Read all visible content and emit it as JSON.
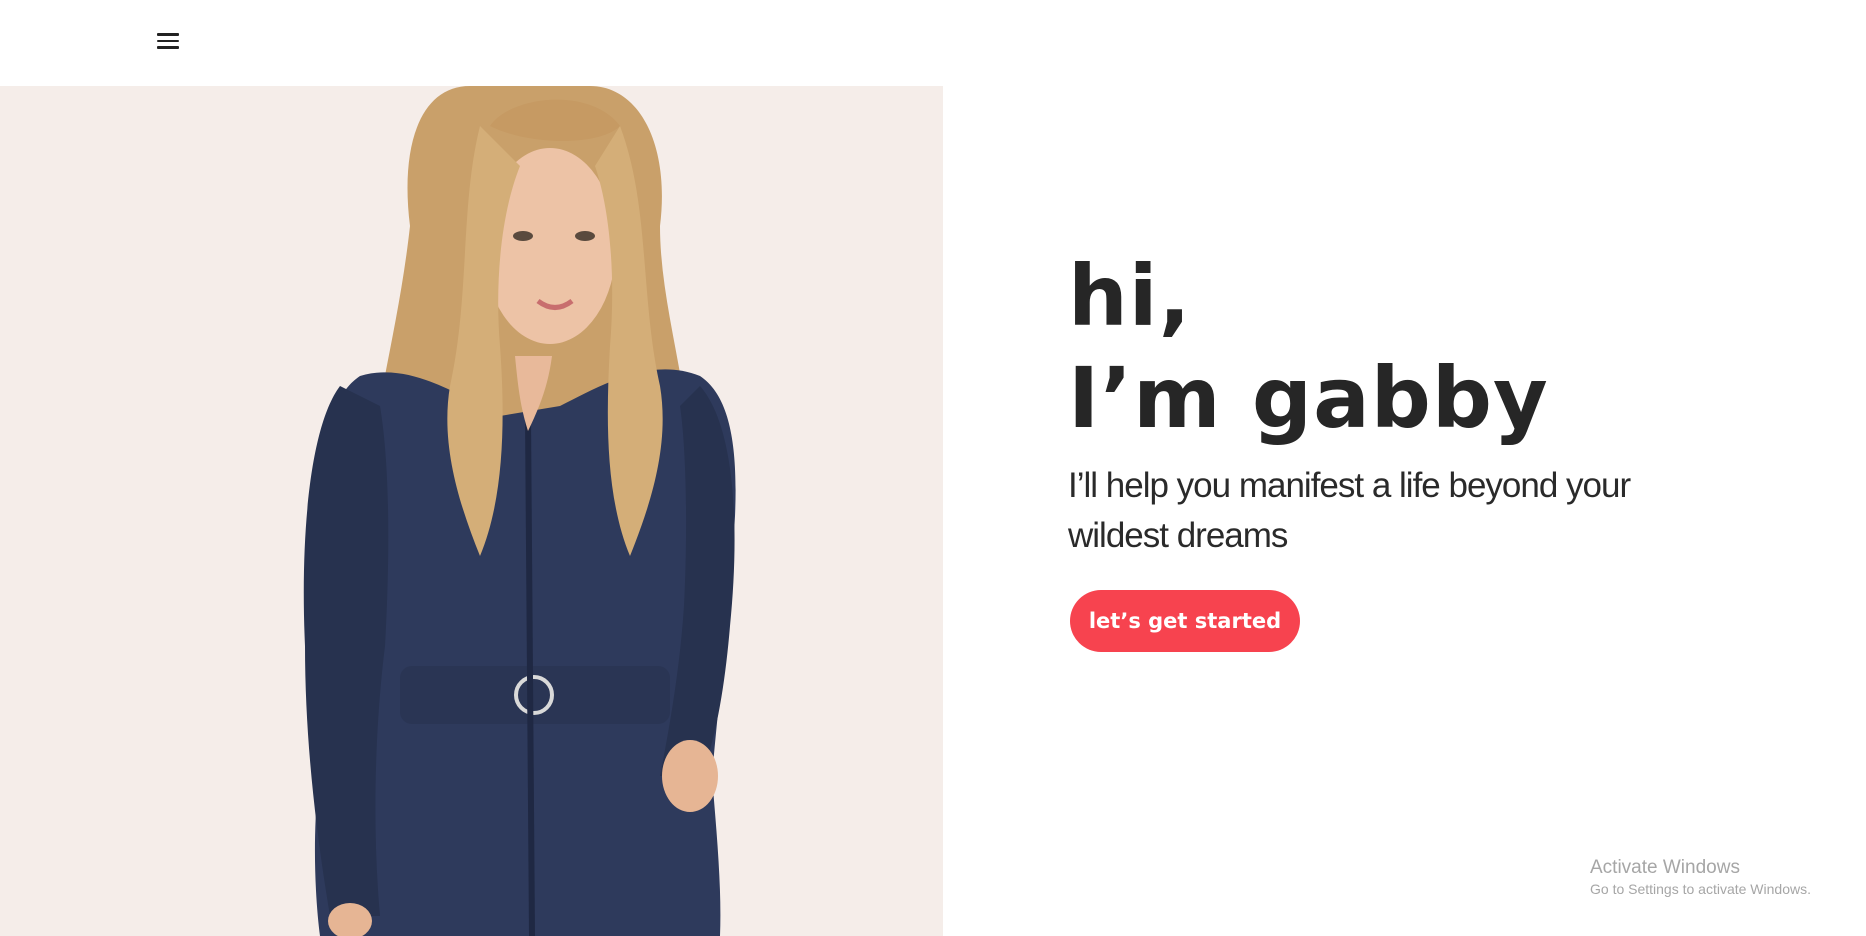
{
  "header": {
    "menu_icon": "hamburger-menu-icon"
  },
  "hero": {
    "image_desc": "portrait-photo",
    "greeting_line1": "hi,",
    "greeting_line2": "I’m gabby",
    "tagline": "I’ll help you manifest a life beyond your wildest dreams",
    "cta_label": "let’s get started"
  },
  "watermark": {
    "title": "Activate Windows",
    "subtitle": "Go to Settings to activate Windows."
  },
  "colors": {
    "accent": "#f7434f",
    "image_bg": "#f5ede9",
    "text": "#262626"
  }
}
